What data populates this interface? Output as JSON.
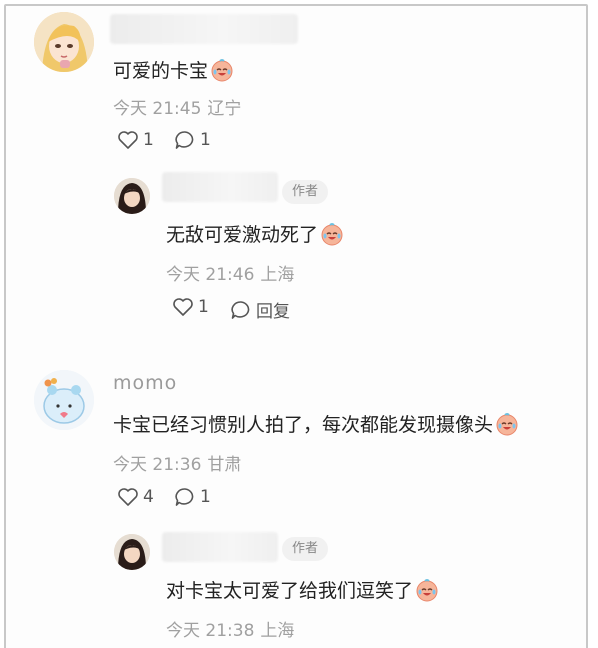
{
  "comments": [
    {
      "text": "可爱的卡宝",
      "time": "今天 21:45",
      "location": "辽宁",
      "likes": "1",
      "replies": "1",
      "reply": {
        "author_tag": "作者",
        "text": "无敌可爱激动死了",
        "time": "今天 21:46",
        "location": "上海",
        "likes": "1",
        "reply_label": "回复"
      }
    },
    {
      "username": "momo",
      "text": "卡宝已经习惯别人拍了，每次都能发现摄像头",
      "time": "今天 21:36",
      "location": "甘肃",
      "likes": "4",
      "replies": "1",
      "reply": {
        "author_tag": "作者",
        "text": "对卡宝太可爱了给我们逗笑了",
        "time": "今天 21:38",
        "location": "上海"
      }
    }
  ],
  "colors": {
    "text": "#222222",
    "meta": "#a0a0a0",
    "tag_bg": "#f1f1f1",
    "border": "#c8c8c8"
  },
  "icons": [
    "heart-outline-icon",
    "comment-bubble-icon",
    "laughing-cry-emoji"
  ]
}
